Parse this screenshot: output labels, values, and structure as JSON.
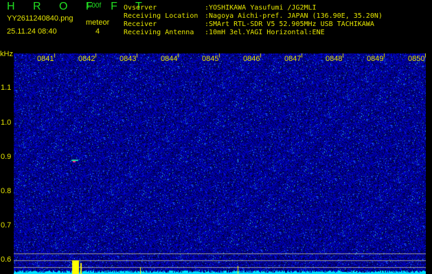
{
  "header": {
    "app_title": "H R O F F T",
    "version": "1.00f",
    "filename": "YY2611240840.png",
    "datetime": "25.11.24 08:40",
    "meteor_label": "meteor",
    "meteor_count": "4"
  },
  "info": [
    {
      "label": "Ovserver",
      "value": ":YOSHIKAWA Yasufumi /JG2MLI"
    },
    {
      "label": "Receiving Location",
      "value": ":Nagoya Aichi-pref. JAPAN (136.90E, 35.20N)"
    },
    {
      "label": "Receiver",
      "value": ":SMArt RTL-SDR V5 52.905MHz USB TACHIKAWA"
    },
    {
      "label": "Receiving Antenna",
      "value": ":10mH 3el.YAGI Horizontal:ENE"
    }
  ],
  "spectrogram": {
    "y_unit": "kHz",
    "y_ticks": [
      "1.1",
      "1.0",
      "0.9",
      "0.8",
      "0.7",
      "0.6"
    ],
    "time_labels": [
      "0841",
      "0842",
      "0843",
      "0844",
      "0845",
      "0846",
      "0847",
      "0848",
      "0849",
      "0850"
    ],
    "colors": {
      "background": "#0a0a90",
      "noise_high": "#3aa0ff",
      "power": "#00e0ff",
      "spike": "#ffff00",
      "text": "#e6e600",
      "title": "#22e022"
    }
  }
}
